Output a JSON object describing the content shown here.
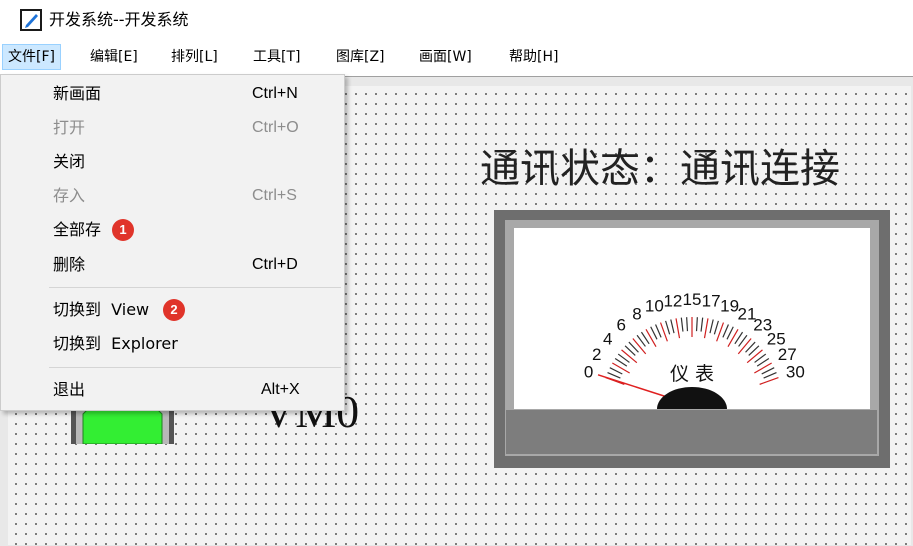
{
  "window": {
    "title": "开发系统--开发系统",
    "icon": "edit-pencil-icon"
  },
  "menubar": {
    "items": [
      {
        "label": "文件[F]",
        "active": true
      },
      {
        "label": "编辑[E]"
      },
      {
        "label": "排列[L]"
      },
      {
        "label": "工具[T]"
      },
      {
        "label": "图库[Z]"
      },
      {
        "label": "画面[W]"
      },
      {
        "label": "帮助[H]"
      }
    ]
  },
  "file_menu": {
    "items": [
      {
        "label": "新画面",
        "shortcut": "Ctrl+N",
        "enabled": true
      },
      {
        "label": "打开",
        "shortcut": "Ctrl+O",
        "enabled": false
      },
      {
        "label": "关闭",
        "shortcut": "",
        "enabled": true
      },
      {
        "label": "存入",
        "shortcut": "Ctrl+S",
        "enabled": false
      },
      {
        "label": "全部存",
        "shortcut": "",
        "enabled": true,
        "badge": "1"
      },
      {
        "label": "删除",
        "shortcut": "Ctrl+D",
        "enabled": true
      },
      {
        "label": "切换到  View",
        "shortcut": "",
        "enabled": true,
        "badge": "2"
      },
      {
        "label": "切换到  Explorer",
        "shortcut": "",
        "enabled": true
      },
      {
        "label": "退出",
        "shortcut": "Alt+X",
        "enabled": true
      }
    ]
  },
  "canvas": {
    "status_text": "通讯状态：通讯连接",
    "vmo_label": "VM0",
    "lamp": {
      "color": "#33ee33",
      "state": "on"
    },
    "meter": {
      "label": "仪 表",
      "scale_labels": [
        "0",
        "2",
        "4",
        "6",
        "8",
        "10",
        "12",
        "15",
        "17",
        "19",
        "21",
        "23",
        "25",
        "27",
        "30"
      ],
      "scale_min": 0,
      "scale_max": 30,
      "needle_value": 0,
      "needle_color": "#e02020"
    }
  },
  "colors": {
    "menu_active_bg": "#cce8ff",
    "badge": "#e0342a",
    "lamp_green": "#33ee33",
    "gauge_frame": "#6e6e6e"
  }
}
